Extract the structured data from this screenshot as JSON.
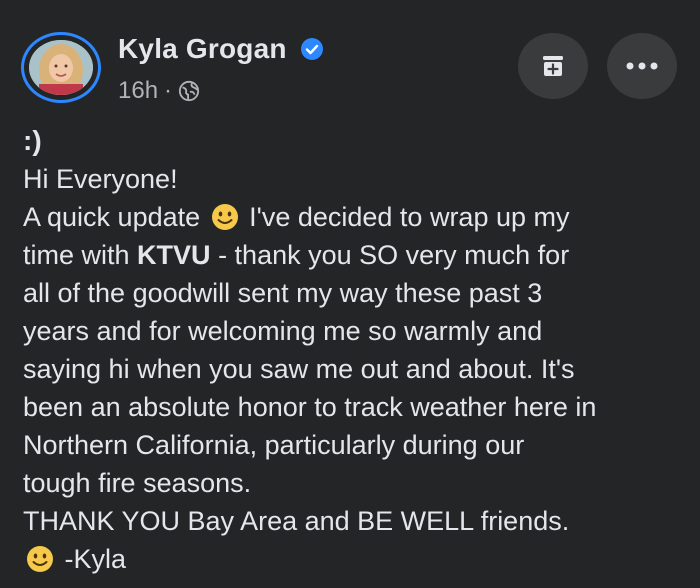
{
  "post": {
    "author": "Kyla Grogan",
    "time": "16h",
    "separator": "·",
    "emoticon_line": ":)",
    "lines": [
      "Hi Everyone!",
      "A quick update",
      "I've decided to wrap up my",
      "time with",
      "KTVU",
      "- thank you SO very much for",
      "all of the goodwill sent my way these past 3",
      "years and for welcoming me so warmly and",
      "saying hi when you saw me out and about. It's",
      "been an absolute honor to track weather here in",
      "Northern California, particularly during our",
      "tough fire seasons.",
      "THANK YOU Bay Area and BE WELL friends.",
      "-Kyla"
    ]
  },
  "icons": {
    "verified": "verified-badge-icon",
    "globe": "globe-icon",
    "save": "save-to-archive-icon",
    "more": "more-options-icon",
    "emoji": "slightly-smiling-face-emoji"
  },
  "colors": {
    "background": "#242526",
    "text": "#e4e6eb",
    "secondary": "#b0b3b8",
    "accent": "#2d88ff",
    "button": "#3a3b3c"
  }
}
